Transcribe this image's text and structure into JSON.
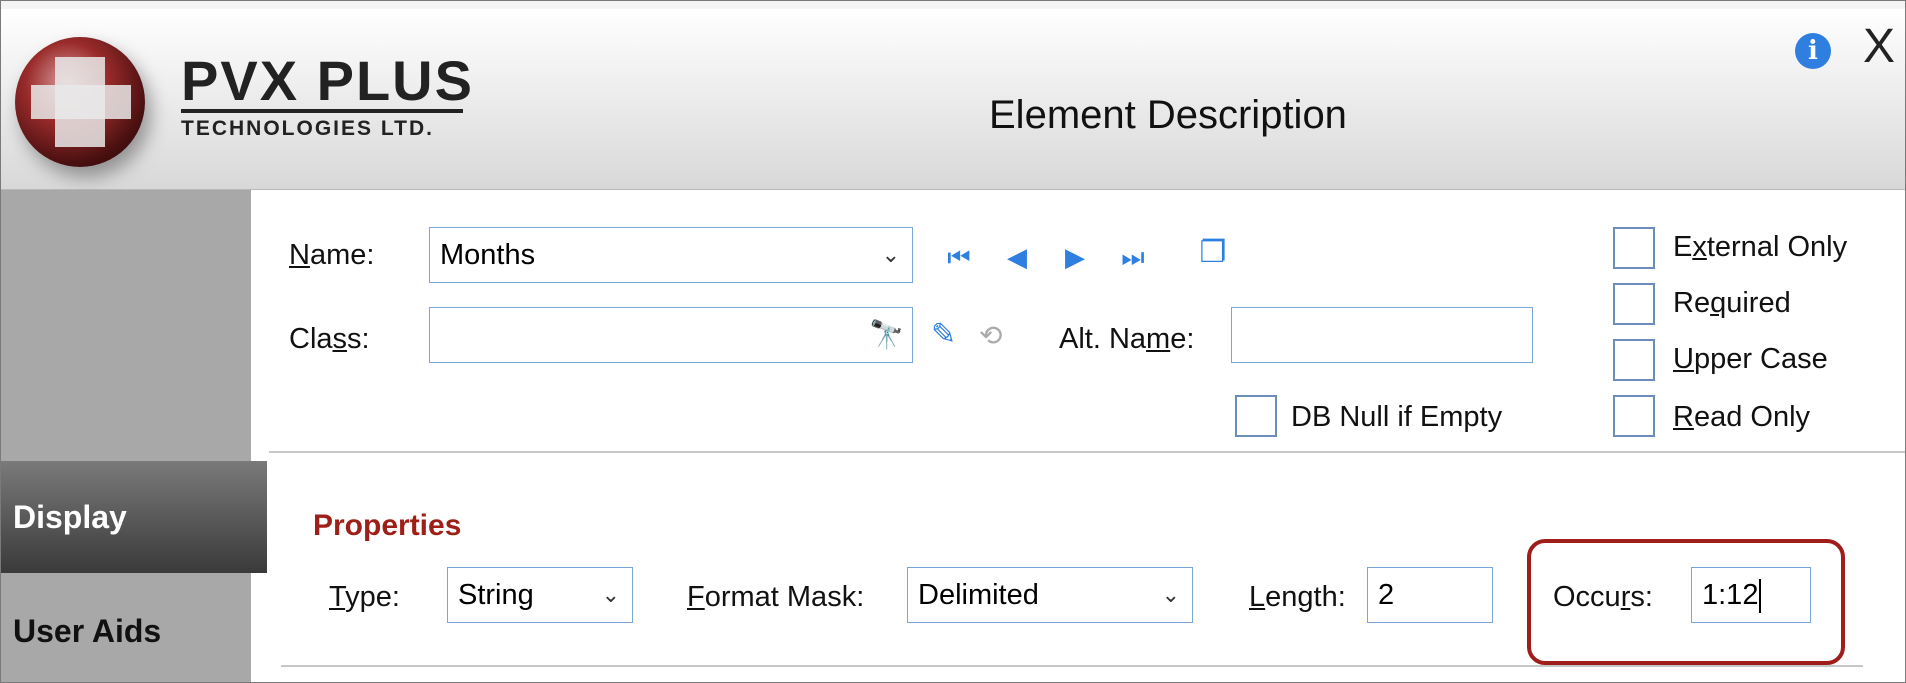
{
  "window": {
    "title": "Element Description",
    "close_glyph": "X",
    "info_glyph": "i"
  },
  "logo": {
    "name": "PVX PLUS",
    "tagline": "TECHNOLOGIES LTD."
  },
  "sidebar": {
    "items": [
      {
        "label": "Display",
        "active": true
      },
      {
        "label": "User Aids",
        "active": false
      }
    ]
  },
  "form": {
    "name_label_prefix": "N",
    "name_label_rest": "ame:",
    "name_value": "Months",
    "class_label_prefix": "Cla",
    "class_label_u": "s",
    "class_label_rest": "s:",
    "class_value": "",
    "altname_label_prefix": "Alt. Na",
    "altname_label_u": "m",
    "altname_label_rest": "e:",
    "altname_value": "",
    "db_null_label": "DB Null if Empty",
    "db_null_checked": false,
    "checkboxes": [
      {
        "prefix": "E",
        "u": "x",
        "rest": "ternal Only",
        "checked": false
      },
      {
        "prefix": "Re",
        "u": "q",
        "rest": "uired",
        "checked": false
      },
      {
        "prefix": "",
        "u": "U",
        "rest": "pper Case",
        "checked": false
      },
      {
        "prefix": "",
        "u": "R",
        "rest": "ead Only",
        "checked": false
      }
    ]
  },
  "properties": {
    "heading": "Properties",
    "type_label_u": "T",
    "type_label_rest": "ype:",
    "type_value": "String",
    "format_label_u": "F",
    "format_label_rest": "ormat Mask:",
    "format_value": "Delimited",
    "length_label_u": "L",
    "length_label_rest": "ength:",
    "length_value": "2",
    "occurs_label_prefix": "Occu",
    "occurs_label_u": "r",
    "occurs_label_rest": "s:",
    "occurs_value": "1:12"
  },
  "icons": [
    "globe-logo-icon",
    "info-icon",
    "close-icon",
    "first-record-icon",
    "previous-record-icon",
    "next-record-icon",
    "last-record-icon",
    "copy-icon",
    "binoculars-icon",
    "edit-icon",
    "link-icon",
    "chevron-down-icon"
  ],
  "colors": {
    "accent_red": "#9d1f18",
    "nav_blue": "#2f7fe0"
  }
}
